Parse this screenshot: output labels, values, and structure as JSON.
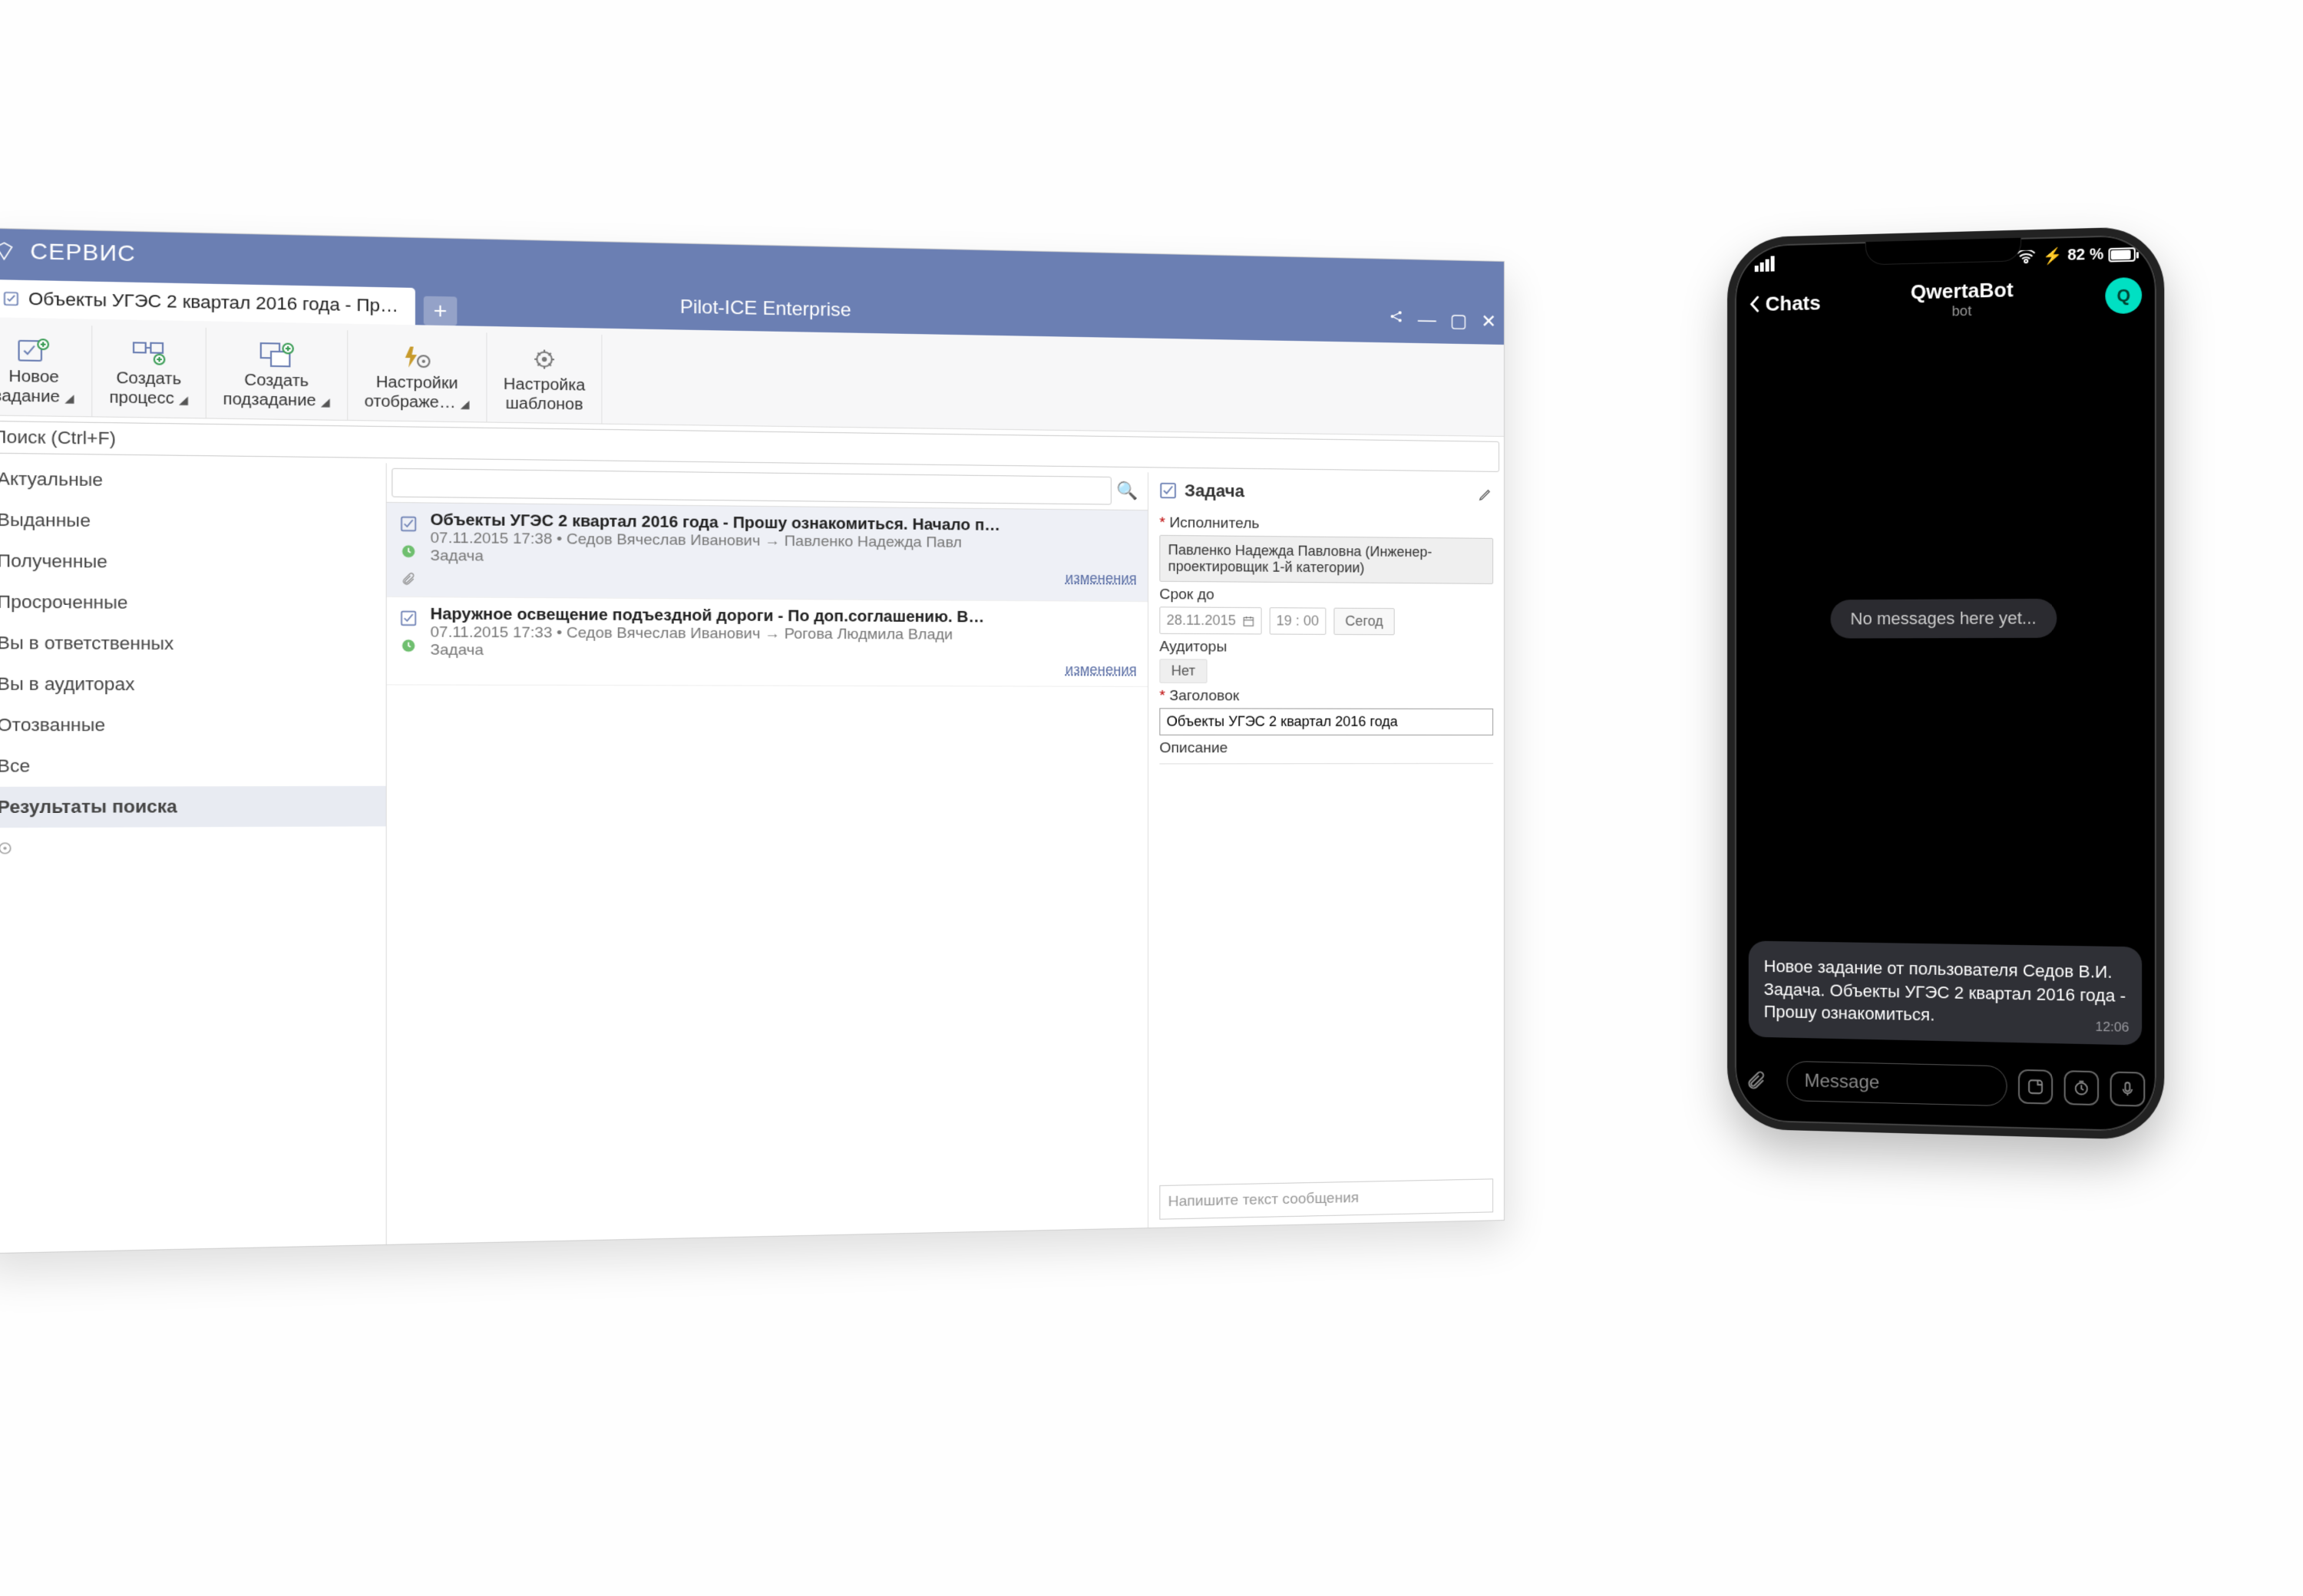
{
  "desktop": {
    "menu": "СЕРВИС",
    "tab_label": "Объекты УГЭС 2 квартал 2016 года - Пр…",
    "app_title": "Pilot-ICE Enterprise",
    "toolbar": {
      "new_task_1": "Новое",
      "new_task_2": "задание",
      "create_proc_1": "Создать",
      "create_proc_2": "процесс",
      "create_sub_1": "Создать",
      "create_sub_2": "подзадание",
      "display_settings_1": "Настройки",
      "display_settings_2": "отображе…",
      "templates_1": "Настройка",
      "templates_2": "шаблонов"
    },
    "search_placeholder": "Поиск (Ctrl+F)",
    "nav": {
      "actual": "Актуальные",
      "issued": "Выданные",
      "received": "Полученные",
      "overdue": "Просроченные",
      "responsible": "Вы в ответственных",
      "auditor": "Вы в аудиторах",
      "recalled": "Отозванные",
      "all": "Все",
      "results": "Результаты поиска"
    },
    "tasks": [
      {
        "title": "Объекты УГЭС 2 квартал 2016 года - Прошу ознакомиться.  Начало п…",
        "meta": "07.11.2015 17:38 • Седов Вячеслав Иванович → Павленко Надежда Павл",
        "type": "Задача",
        "changes": "изменения"
      },
      {
        "title": "Наружное освещение подъездной дороги - По доп.соглашению.  В…",
        "meta": "07.11.2015 17:33 • Седов Вячеслав Иванович → Рогова Людмила Влади",
        "type": "Задача",
        "changes": "изменения"
      }
    ],
    "details": {
      "header": "Задача",
      "executor_label": "Исполнитель",
      "executor_value": "Павленко Надежда Павловна (Инженер-проектировщик 1-й категории)",
      "deadline_label": "Срок до",
      "date": "28.11.2015",
      "time": "19 : 00",
      "today": "Сегод",
      "auditors_label": "Аудиторы",
      "auditors_value": "Нет",
      "title_label": "Заголовок",
      "title_value": "Объекты УГЭС 2 квартал 2016 года",
      "desc_label": "Описание",
      "msg_placeholder": "Напишите текст сообщения"
    }
  },
  "phone": {
    "battery": "82 %",
    "back": "Chats",
    "title": "QwertaBot",
    "subtitle": "bot",
    "avatar_letter": "Q",
    "empty": "No messages here yet...",
    "bubble": "Новое задание от пользователя Седов В.И.\nЗадача. Объекты УГЭС 2 квартал 2016 года - Прошу ознакомиться.",
    "bubble_time": "12:06",
    "input_placeholder": "Message"
  }
}
